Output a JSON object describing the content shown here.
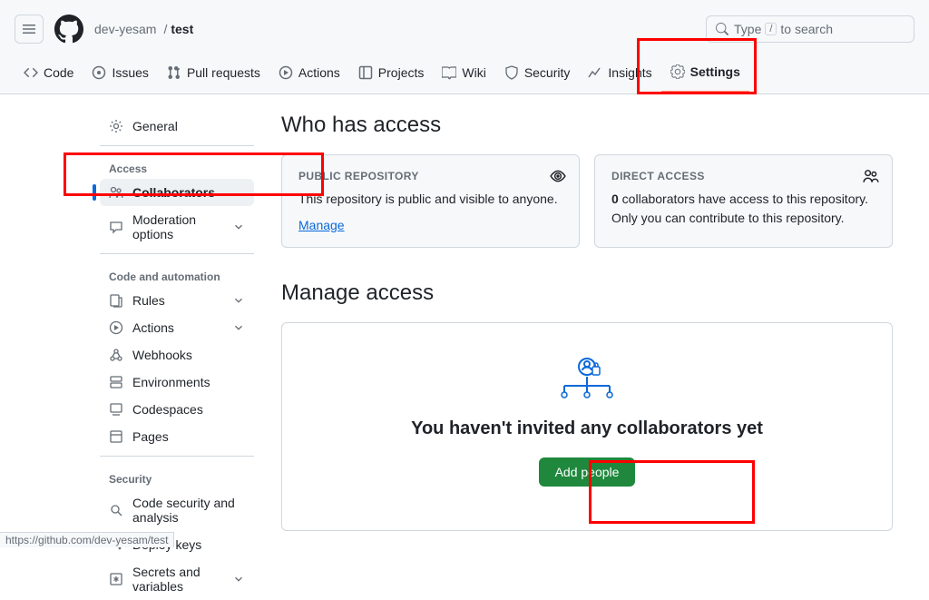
{
  "header": {
    "owner": "dev-yesam",
    "repo": "test",
    "search_pre": "Type",
    "search_slash": "/",
    "search_post": "to search"
  },
  "tabs": {
    "code": "Code",
    "issues": "Issues",
    "pull": "Pull requests",
    "actions": "Actions",
    "projects": "Projects",
    "wiki": "Wiki",
    "security": "Security",
    "insights": "Insights",
    "settings": "Settings"
  },
  "sidebar": {
    "general": "General",
    "sec_access": "Access",
    "collaborators": "Collaborators",
    "moderation": "Moderation options",
    "sec_codeauto": "Code and automation",
    "rules": "Rules",
    "actions": "Actions",
    "webhooks": "Webhooks",
    "environments": "Environments",
    "codespaces": "Codespaces",
    "pages": "Pages",
    "sec_security": "Security",
    "codesec": "Code security and analysis",
    "deploy": "Deploy keys",
    "secrets": "Secrets and variables"
  },
  "access": {
    "heading": "Who has access",
    "public_title": "PUBLIC REPOSITORY",
    "public_body": "This repository is public and visible to anyone.",
    "public_manage": "Manage",
    "direct_title": "DIRECT ACCESS",
    "direct_count": "0",
    "direct_body": " collaborators have access to this repository. Only you can contribute to this repository."
  },
  "manage": {
    "heading": "Manage access",
    "empty": "You haven't invited any collaborators yet",
    "add_btn": "Add people"
  },
  "statusbar": "https://github.com/dev-yesam/test"
}
